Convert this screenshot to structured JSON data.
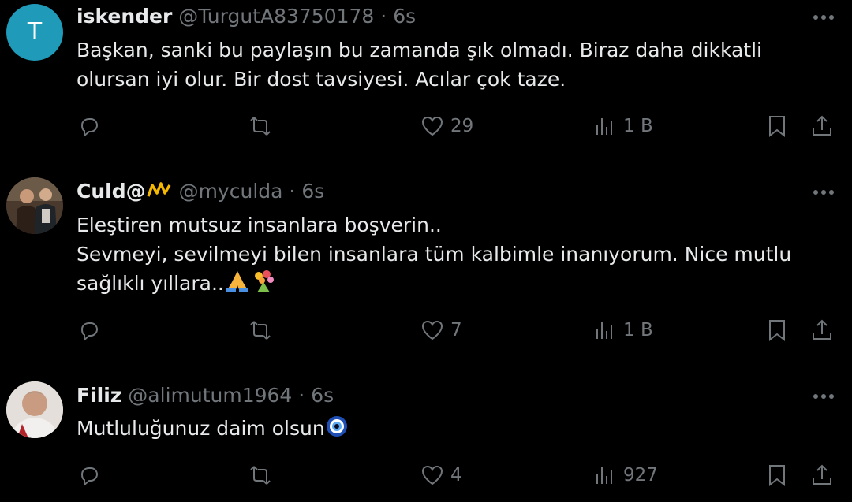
{
  "colors": {
    "background": "#000000",
    "text_primary": "#e7e9ea",
    "text_secondary": "#71767b",
    "divider": "#2f3336",
    "avatar_t": "#1f9ab8"
  },
  "tweets": [
    {
      "avatar_letter": "T",
      "name": "iskender",
      "handle": "@TurgutA83750178",
      "separator": "·",
      "time": "6s",
      "lines": [
        "Başkan, sanki bu paylaşın bu zamanda şık olmadı. Biraz daha dikkatli",
        "olursan iyi olur. Bir dost tavsiyesi. Acılar çok taze."
      ],
      "like_count": "29",
      "view_count": "1 B"
    },
    {
      "name": "Culd@",
      "handle": "@myculda",
      "separator": "·",
      "time": "6s",
      "lines": [
        "Eleştiren mutsuz insanlara boşverin..",
        "Sevmeyi, sevilmeyi bilen insanlara tüm kalbimle inanıyorum. Nice mutlu",
        "sağlıklı yıllara.."
      ],
      "like_count": "7",
      "view_count": "1 B"
    },
    {
      "name": "Filiz",
      "handle": "@alimutum1964",
      "separator": "·",
      "time": "6s",
      "lines": [
        "Mutluluğunuz daim olsun"
      ],
      "like_count": "4",
      "view_count": "927"
    }
  ],
  "icons": {
    "more": "more-horizontal-icon",
    "reply": "reply-icon",
    "retweet": "retweet-icon",
    "like": "heart-icon",
    "views": "views-icon",
    "bookmark": "bookmark-icon",
    "share": "share-icon"
  }
}
